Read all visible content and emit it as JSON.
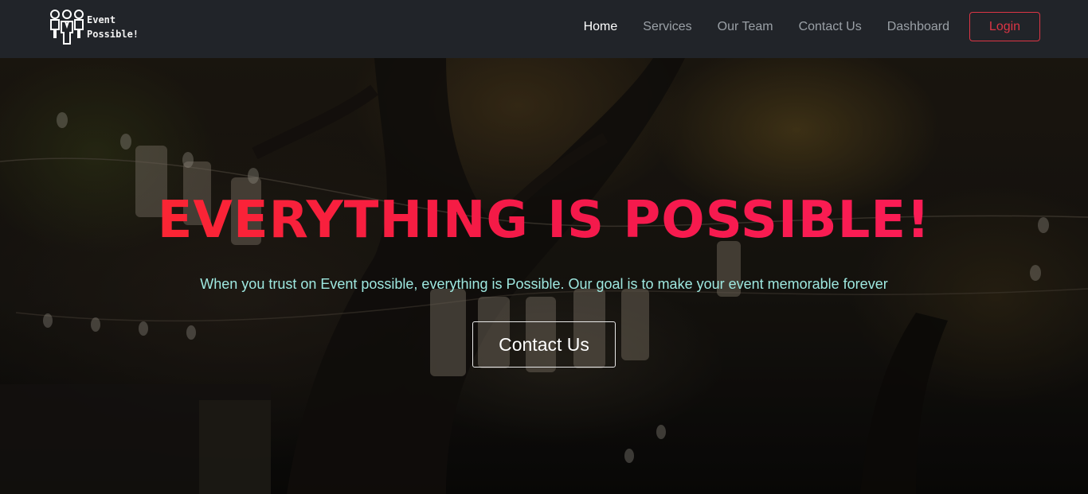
{
  "brand": {
    "line1": "Event",
    "line2": "Possible!",
    "icon": "people-group-icon"
  },
  "nav": {
    "items": [
      {
        "label": "Home",
        "active": true
      },
      {
        "label": "Services",
        "active": false
      },
      {
        "label": "Our Team",
        "active": false
      },
      {
        "label": "Contact Us",
        "active": false
      },
      {
        "label": "Dashboard",
        "active": false
      }
    ],
    "login_label": "Login"
  },
  "hero": {
    "title": "EVERYTHING IS POSSIBLE!",
    "subtitle": "When you trust on Event possible, everything is Possible. Our goal is to make your event memorable forever",
    "cta_label": "Contact Us"
  },
  "colors": {
    "navbar_bg": "#212429",
    "accent": "#dc3545",
    "title": "#f01c3c",
    "subtitle": "#9ee8e0"
  }
}
